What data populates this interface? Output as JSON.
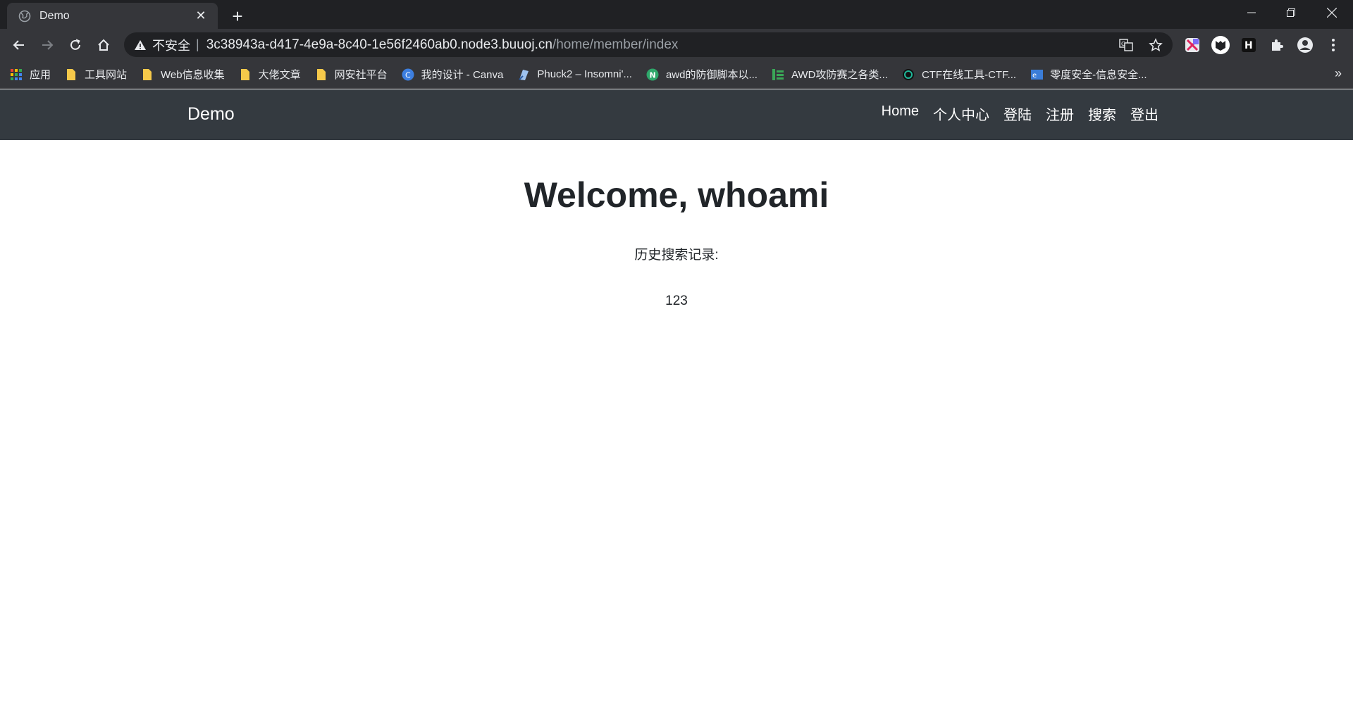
{
  "browser": {
    "tab_title": "Demo",
    "insecure_label": "不安全",
    "url_host": "3c38943a-d417-4e9a-8c40-1e56f2460ab0.node3.buuoj.cn",
    "url_path": "/home/member/index",
    "bookmarks": [
      {
        "label": "应用",
        "icon": "apps-grid-icon"
      },
      {
        "label": "工具网站",
        "icon": "folder-icon"
      },
      {
        "label": "Web信息收集",
        "icon": "folder-icon"
      },
      {
        "label": "大佬文章",
        "icon": "folder-icon"
      },
      {
        "label": "网安社平台",
        "icon": "folder-icon"
      },
      {
        "label": "我的设计 - Canva",
        "icon": "canva-icon"
      },
      {
        "label": "Phuck2 – Insomni'...",
        "icon": "page-icon"
      },
      {
        "label": "awd的防御脚本以...",
        "icon": "n-icon"
      },
      {
        "label": "AWD攻防赛之各类...",
        "icon": "bars-icon"
      },
      {
        "label": "CTF在线工具-CTF...",
        "icon": "circle-icon"
      },
      {
        "label": "零度安全-信息安全...",
        "icon": "site-icon"
      }
    ],
    "more_bookmarks": "»"
  },
  "site": {
    "brand": "Demo",
    "nav": [
      "Home",
      "个人中心",
      "登陆",
      "注册",
      "搜索",
      "登出"
    ]
  },
  "main": {
    "welcome": "Welcome, whoami",
    "history_label": "历史搜索记录:",
    "history_items": [
      "123"
    ]
  },
  "colors": {
    "navbar_bg": "#343a40",
    "chrome_dark": "#202124",
    "chrome_toolbar": "#35363a"
  }
}
